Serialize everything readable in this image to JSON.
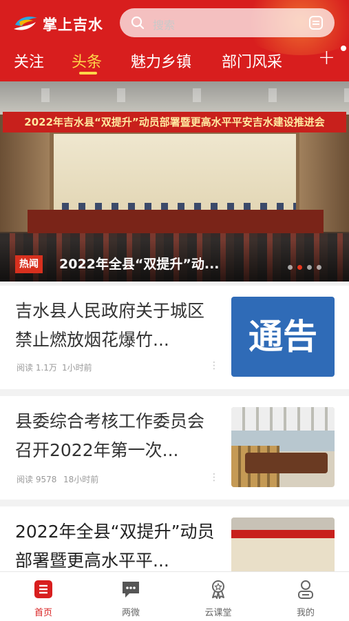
{
  "header": {
    "app_name": "掌上吉水",
    "search_placeholder": "搜索",
    "tabs": [
      {
        "label": "关注",
        "active": false
      },
      {
        "label": "头条",
        "active": true
      },
      {
        "label": "魅力乡镇",
        "active": false
      },
      {
        "label": "部门风采",
        "active": false
      }
    ],
    "add_tab_label": "+"
  },
  "banner": {
    "scene_text": "2022年吉水县“双提升”动员部署暨更高水平平安吉水建设推进会",
    "tag": "热闻",
    "title": "2022年全县“双提升”动...",
    "page_count": 4,
    "active_page": 1
  },
  "articles": [
    {
      "title": "吉水县人民政府关于城区禁止燃放烟花爆竹...",
      "reads": "阅读 1.1万",
      "time": "1小时前",
      "image_text": "通告",
      "image_type": "notice"
    },
    {
      "title": "县委综合考核工作委员会召开2022年第一次...",
      "reads": "阅读 9578",
      "time": "18小时前",
      "image_type": "meeting"
    },
    {
      "title": "2022年全县“双提升”动员部署暨更高水平平...",
      "image_type": "conference"
    }
  ],
  "more_glyph": "⋮",
  "bottom_nav": [
    {
      "label": "首页",
      "icon": "home-icon",
      "active": true
    },
    {
      "label": "两微",
      "icon": "chat-icon",
      "active": false
    },
    {
      "label": "云课堂",
      "icon": "medal-icon",
      "active": false
    },
    {
      "label": "我的",
      "icon": "user-icon",
      "active": false
    }
  ],
  "colors": {
    "brand_red": "#d81e1e",
    "active_tab": "#ffd74a",
    "notice_blue": "#2f6bb7"
  }
}
